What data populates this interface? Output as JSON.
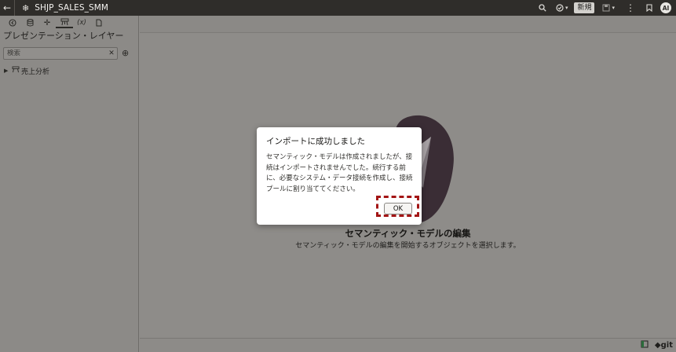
{
  "header": {
    "title": "SHJP_SALES_SMM",
    "new_label": "新規",
    "avatar_initials": "AI",
    "icons": [
      "back-arrow-icon",
      "model-snowflake-icon",
      "search-icon",
      "check-circle-icon",
      "save-icon",
      "more-vertical-icon",
      "bookmark-icon"
    ]
  },
  "sidebar": {
    "toolbar_icons": [
      "back-icon",
      "database-icon",
      "move-icon",
      "presentation-icon",
      "variable-icon",
      "document-icon"
    ],
    "variable_label": "(x)",
    "title": "プレゼンテーション・レイヤー",
    "search": {
      "placeholder": "検索",
      "value": ""
    },
    "tree": [
      {
        "label": "売上分析"
      }
    ]
  },
  "main": {
    "empty_title": "セマンティック・モデルの編集",
    "empty_subtitle": "セマンティック・モデルの編集を開始するオブジェクトを選択します。",
    "bottom": {
      "git_label": "git"
    }
  },
  "dialog": {
    "title": "インポートに成功しました",
    "body_lines": [
      "セマンティック・モデルは作成されましたが、接",
      "続はインポートされませんでした。続行する前",
      "に、必要なシステム・データ接続を作成し、接続",
      "プールに割り当ててください。"
    ],
    "ok_label": "OK"
  },
  "colors": {
    "header_bg": "#2f2d2a",
    "overlay_bg": "#8e8c89",
    "dialog_bg": "#ffffff",
    "highlight_border": "#a31515",
    "art_shape": "#3a2d35"
  }
}
